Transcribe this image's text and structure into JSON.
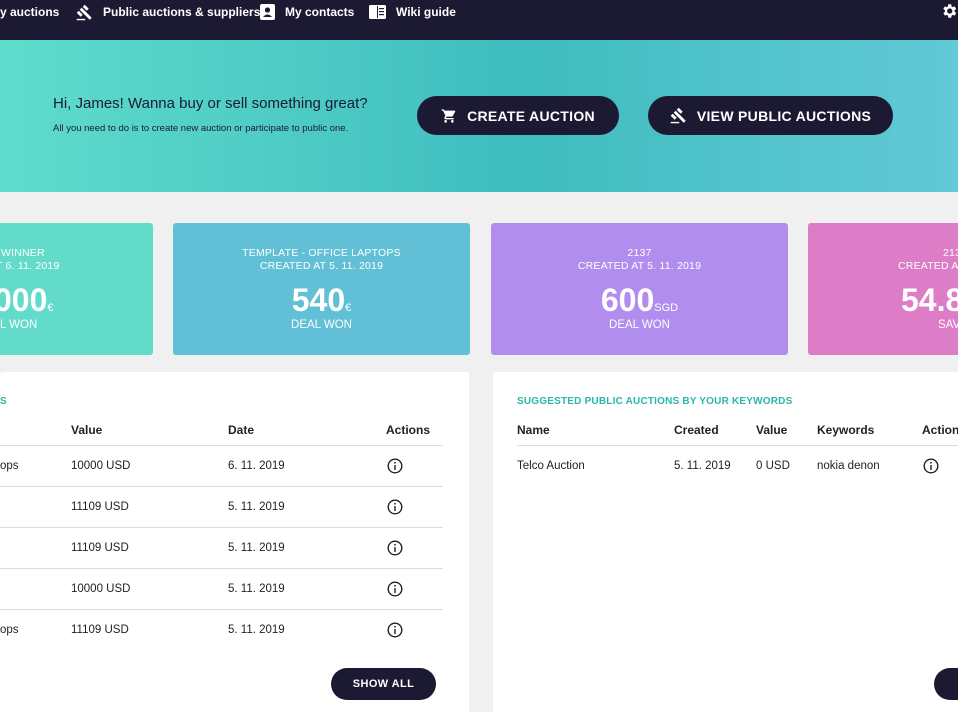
{
  "nav": {
    "my_auctions": "y auctions",
    "public_auctions": "Public auctions & suppliers",
    "my_contacts": "My contacts",
    "wiki": "Wiki guide"
  },
  "hero": {
    "title": "Hi, James! Wanna buy or sell something great?",
    "subtitle": "All you need to do is to create new auction or participate to public one.",
    "create_label": "CREATE AUCTION",
    "view_label": "VIEW PUBLIC AUCTIONS"
  },
  "stats": [
    {
      "line1": "WINNER",
      "line2": "T 6. 11. 2019",
      "value": "000",
      "unit": "€",
      "caption": "L WON",
      "color": "#62dbca"
    },
    {
      "line1": "TEMPLATE - OFFICE LAPTOPS",
      "line2": "CREATED AT 5. 11. 2019",
      "value": "540",
      "unit": "€",
      "caption": "DEAL WON",
      "color": "#61c0d6"
    },
    {
      "line1": "2137",
      "line2": "CREATED AT 5. 11. 2019",
      "value": "600",
      "unit": "SGD",
      "caption": "DEAL WON",
      "color": "#b18ded"
    },
    {
      "line1": "213",
      "line2": "CREATED AT",
      "value": "54.8",
      "unit": "",
      "caption": "SAV",
      "color": "#dd7cc7"
    }
  ],
  "left_panel": {
    "title": "S",
    "headers": {
      "value": "Value",
      "date": "Date",
      "actions": "Actions"
    },
    "rows": [
      {
        "name": "ops",
        "value": "10000 USD",
        "date": "6. 11. 2019"
      },
      {
        "name": "",
        "value": "11109 USD",
        "date": "5. 11. 2019"
      },
      {
        "name": "",
        "value": "11109 USD",
        "date": "5. 11. 2019"
      },
      {
        "name": "",
        "value": "10000 USD",
        "date": "5. 11. 2019"
      },
      {
        "name": "ops",
        "value": "11109 USD",
        "date": "5. 11. 2019"
      }
    ],
    "show_all": "SHOW ALL"
  },
  "right_panel": {
    "title": "SUGGESTED PUBLIC AUCTIONS BY YOUR KEYWORDS",
    "headers": {
      "name": "Name",
      "created": "Created",
      "value": "Value",
      "keywords": "Keywords",
      "actions": "Action"
    },
    "rows": [
      {
        "name": "Telco Auction",
        "created": "5. 11. 2019",
        "value": "0 USD",
        "keywords": "nokia denon"
      }
    ]
  },
  "icons": [
    "gavel-icon",
    "contact-card-icon",
    "book-icon",
    "gear-icon",
    "cart-icon",
    "info-icon"
  ]
}
